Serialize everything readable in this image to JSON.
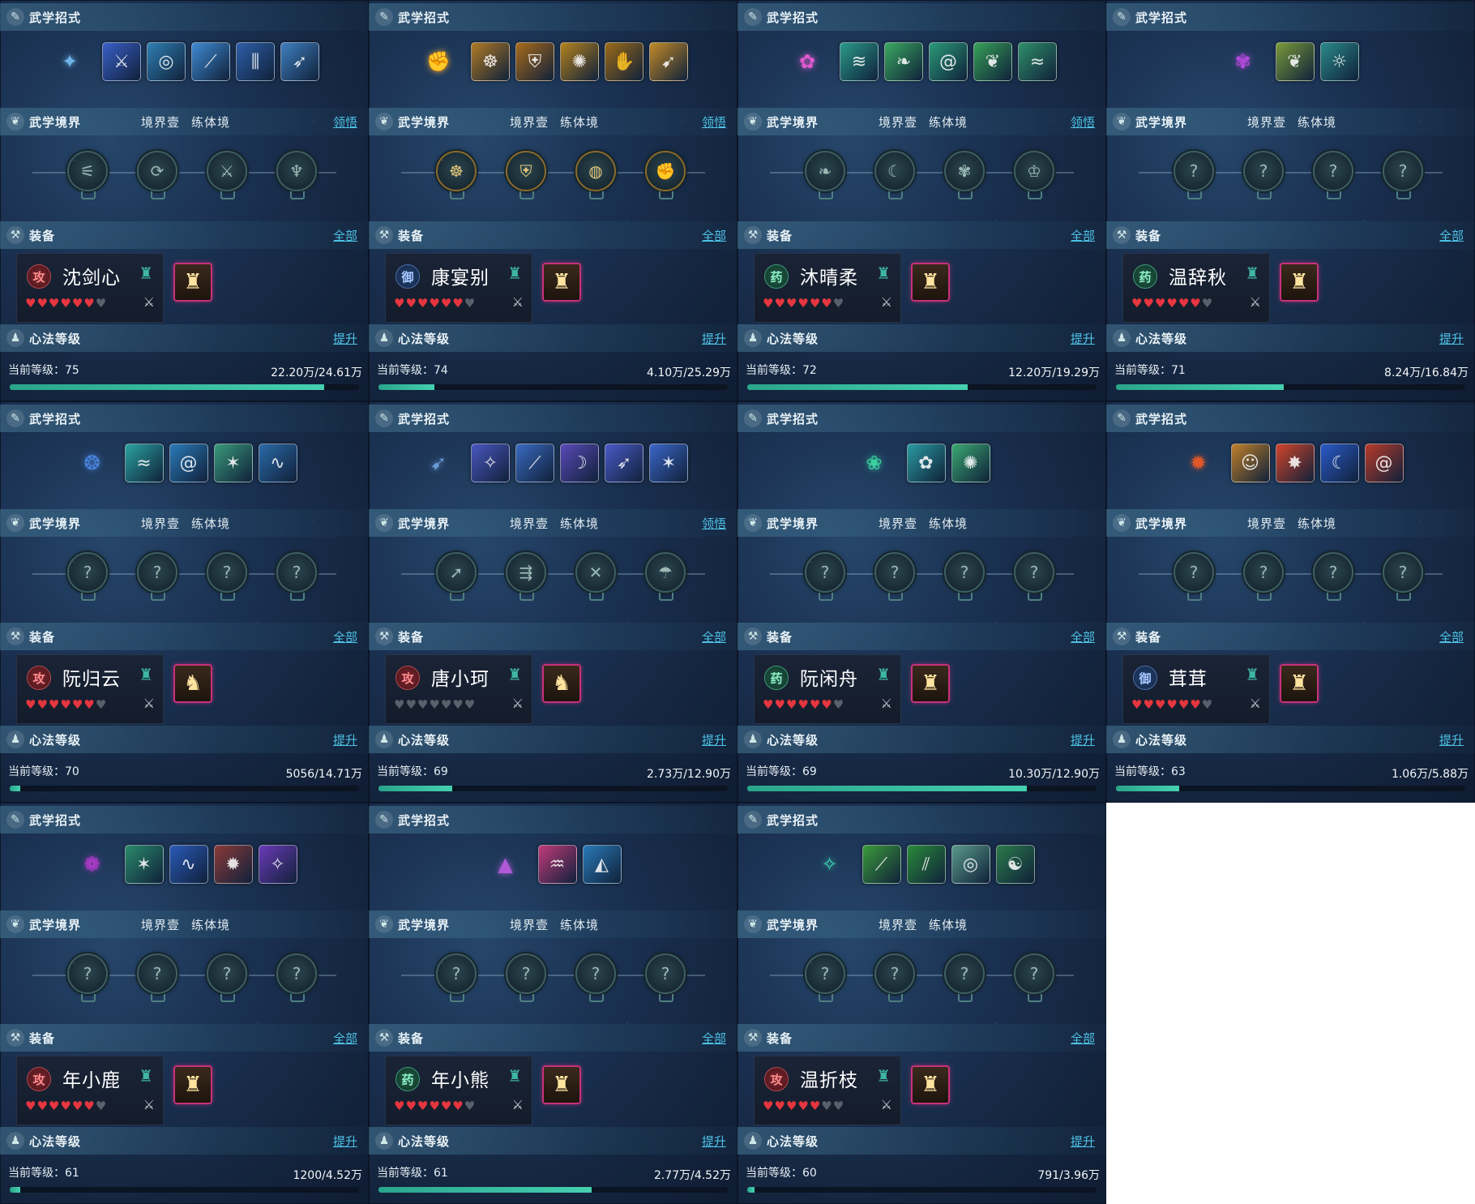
{
  "labels": {
    "skills": "武学招式",
    "realm": "武学境界",
    "equip": "装备",
    "mind": "心法等级",
    "level_prefix": "当前等级：",
    "all": "全部",
    "upgrade": "提升",
    "comprehend": "领悟",
    "realm_stage": "境界壹",
    "realm_name": "练体境"
  },
  "colors": {
    "hp": "#e6363f",
    "hp_empty": "#59606c",
    "accent": "#4ec2e6",
    "xp_bar": "#45d0b0",
    "card_bg": "#1b3253"
  },
  "cards": [
    {
      "name": "沈剑心",
      "role": "攻",
      "role_type": "atk",
      "hearts": 6,
      "level": "75",
      "xp": "22.20万/24.61万",
      "progress": 0.9,
      "comprehend": true,
      "main_skill": {
        "icon": "wind-orb-icon",
        "glyph": "✦",
        "color": "#6fb4e8"
      },
      "skills": [
        {
          "icon": "slash-icon",
          "glyph": "⚔",
          "bg": "#3a5fc8"
        },
        {
          "icon": "whirl-icon",
          "glyph": "◎",
          "bg": "#2f7fb3"
        },
        {
          "icon": "blade-icon",
          "glyph": "⟋",
          "bg": "#3f8bd4"
        },
        {
          "icon": "pierce-icon",
          "glyph": "⫼",
          "bg": "#2d5fa8"
        },
        {
          "icon": "leap-icon",
          "glyph": "➶",
          "bg": "#3f7fc0"
        }
      ],
      "nodes": [
        {
          "icon": "claw-icon",
          "glyph": "⚟",
          "lit": false
        },
        {
          "icon": "swirl-icon",
          "glyph": "⟳",
          "lit": false
        },
        {
          "icon": "sword-icon",
          "glyph": "⚔",
          "lit": false
        },
        {
          "icon": "blade-icon",
          "glyph": "♆",
          "lit": false
        }
      ],
      "gear": {
        "icon": "armor-gold-icon",
        "glyph": "♜"
      }
    },
    {
      "name": "康宴别",
      "role": "御",
      "role_type": "def",
      "hearts": 6,
      "level": "74",
      "xp": "4.10万/25.29万",
      "progress": 0.16,
      "comprehend": true,
      "main_skill": {
        "icon": "golden-fist-icon",
        "glyph": "✊",
        "color": "#e0a83a"
      },
      "skills": [
        {
          "icon": "monk-icon",
          "glyph": "☸",
          "bg": "#b07a24"
        },
        {
          "icon": "bell-icon",
          "glyph": "⛨",
          "bg": "#a86a1a"
        },
        {
          "icon": "shield-icon",
          "glyph": "✺",
          "bg": "#b4821e"
        },
        {
          "icon": "palm-icon",
          "glyph": "✋",
          "bg": "#9a6a18"
        },
        {
          "icon": "kick-icon",
          "glyph": "➹",
          "bg": "#c28a28"
        }
      ],
      "nodes": [
        {
          "icon": "monk-icon",
          "glyph": "☸",
          "lit": true
        },
        {
          "icon": "guard-icon",
          "glyph": "⛨",
          "lit": true
        },
        {
          "icon": "ring-icon",
          "glyph": "◍",
          "lit": true
        },
        {
          "icon": "fist-icon",
          "glyph": "✊",
          "lit": true
        }
      ],
      "gear": {
        "icon": "armor-gold-icon",
        "glyph": "♜"
      }
    },
    {
      "name": "沐晴柔",
      "role": "药",
      "role_type": "heal",
      "hearts": 6,
      "level": "72",
      "xp": "12.20万/19.29万",
      "progress": 0.63,
      "comprehend": true,
      "main_skill": {
        "icon": "fairy-icon",
        "glyph": "✿",
        "color": "#e05ad0"
      },
      "skills": [
        {
          "icon": "wave-icon",
          "glyph": "≋",
          "bg": "#2a9a8a"
        },
        {
          "icon": "leaf-icon",
          "glyph": "❧",
          "bg": "#3aa860"
        },
        {
          "icon": "spiral-icon",
          "glyph": "@",
          "bg": "#2a9a78"
        },
        {
          "icon": "vine-icon",
          "glyph": "❦",
          "bg": "#36a058"
        },
        {
          "icon": "dragon-icon",
          "glyph": "≈",
          "bg": "#2f8f6a"
        }
      ],
      "nodes": [
        {
          "icon": "leaf-icon",
          "glyph": "❧",
          "lit": false
        },
        {
          "icon": "moon-icon",
          "glyph": "☾",
          "lit": false
        },
        {
          "icon": "lotus-icon",
          "glyph": "✾",
          "lit": false
        },
        {
          "icon": "crown-icon",
          "glyph": "♔",
          "lit": false
        }
      ],
      "gear": {
        "icon": "armor-red-icon",
        "glyph": "♜"
      }
    },
    {
      "name": "温辞秋",
      "role": "药",
      "role_type": "heal",
      "hearts": 6,
      "level": "71",
      "xp": "8.24万/16.84万",
      "progress": 0.48,
      "comprehend": false,
      "main_skill": {
        "icon": "flower-icon",
        "glyph": "✾",
        "color": "#b64adf"
      },
      "skills": [
        {
          "icon": "wings-icon",
          "glyph": "❦",
          "bg": "#7a9a3a"
        },
        {
          "icon": "sun-icon",
          "glyph": "☼",
          "bg": "#2a8a8a"
        }
      ],
      "nodes": [
        {
          "icon": "unknown-icon",
          "glyph": "?",
          "lit": false
        },
        {
          "icon": "unknown-icon",
          "glyph": "?",
          "lit": false
        },
        {
          "icon": "unknown-icon",
          "glyph": "?",
          "lit": false
        },
        {
          "icon": "unknown-icon",
          "glyph": "?",
          "lit": false
        }
      ],
      "gear": {
        "icon": "armor-gold-icon",
        "glyph": "♜"
      }
    },
    {
      "name": "阮归云",
      "role": "攻",
      "role_type": "atk",
      "hearts": 6,
      "level": "70",
      "xp": "5056/14.71万",
      "progress": 0.03,
      "comprehend": false,
      "main_skill": {
        "icon": "blue-flame-icon",
        "glyph": "❂",
        "color": "#4a86e0"
      },
      "skills": [
        {
          "icon": "stream-icon",
          "glyph": "≈",
          "bg": "#2aa2a0"
        },
        {
          "icon": "vortex-icon",
          "glyph": "@",
          "bg": "#2a7ab8"
        },
        {
          "icon": "burst-icon",
          "glyph": "✶",
          "bg": "#3a9a7a"
        },
        {
          "icon": "tide-icon",
          "glyph": "∿",
          "bg": "#2a6aa8"
        }
      ],
      "nodes": [
        {
          "icon": "unknown-icon",
          "glyph": "?",
          "lit": false
        },
        {
          "icon": "unknown-icon",
          "glyph": "?",
          "lit": false
        },
        {
          "icon": "unknown-icon",
          "glyph": "?",
          "lit": false
        },
        {
          "icon": "unknown-icon",
          "glyph": "?",
          "lit": false
        }
      ],
      "gear": {
        "icon": "robe-brown-icon",
        "glyph": "♞"
      }
    },
    {
      "name": "唐小珂",
      "role": "攻",
      "role_type": "atk",
      "hearts": 0,
      "level": "69",
      "xp": "2.73万/12.90万",
      "progress": 0.21,
      "comprehend": true,
      "main_skill": {
        "icon": "bird-icon",
        "glyph": "➹",
        "color": "#6a9ad8"
      },
      "skills": [
        {
          "icon": "dancer-icon",
          "glyph": "✧",
          "bg": "#4a56c0"
        },
        {
          "icon": "feather-icon",
          "glyph": "⟋",
          "bg": "#3a6ac0"
        },
        {
          "icon": "scythe-icon",
          "glyph": "☽",
          "bg": "#5a4ab8"
        },
        {
          "icon": "spear-icon",
          "glyph": "➶",
          "bg": "#4a5ac8"
        },
        {
          "icon": "strike-icon",
          "glyph": "✶",
          "bg": "#3a66c8"
        }
      ],
      "nodes": [
        {
          "icon": "bow-icon",
          "glyph": "➚",
          "lit": false
        },
        {
          "icon": "arrows-icon",
          "glyph": "⇶",
          "lit": false
        },
        {
          "icon": "cross-icon",
          "glyph": "✕",
          "lit": false
        },
        {
          "icon": "umbrella-icon",
          "glyph": "☂",
          "lit": false
        }
      ],
      "gear": {
        "icon": "robe-brown-icon",
        "glyph": "♞"
      }
    },
    {
      "name": "阮闲舟",
      "role": "药",
      "role_type": "heal",
      "hearts": 6,
      "level": "69",
      "xp": "10.30万/12.90万",
      "progress": 0.8,
      "comprehend": false,
      "main_skill": {
        "icon": "leaf-spirit-icon",
        "glyph": "❀",
        "color": "#3ad0a0"
      },
      "skills": [
        {
          "icon": "bloom-icon",
          "glyph": "✿",
          "bg": "#2a9aa0"
        },
        {
          "icon": "sunburst-icon",
          "glyph": "✺",
          "bg": "#3aa870"
        }
      ],
      "nodes": [
        {
          "icon": "unknown-icon",
          "glyph": "?",
          "lit": false
        },
        {
          "icon": "unknown-icon",
          "glyph": "?",
          "lit": false
        },
        {
          "icon": "unknown-icon",
          "glyph": "?",
          "lit": false
        },
        {
          "icon": "unknown-icon",
          "glyph": "?",
          "lit": false
        }
      ],
      "gear": {
        "icon": "armor-dark-icon",
        "glyph": "♜"
      }
    },
    {
      "name": "茸茸",
      "role": "御",
      "role_type": "def",
      "hearts": 6,
      "level": "63",
      "xp": "1.06万/5.88万",
      "progress": 0.18,
      "comprehend": false,
      "main_skill": {
        "icon": "fire-spirit-icon",
        "glyph": "✹",
        "color": "#e0582a"
      },
      "skills": [
        {
          "icon": "face-icon",
          "glyph": "☺",
          "bg": "#c0802a"
        },
        {
          "icon": "explosion-icon",
          "glyph": "✸",
          "bg": "#d0442a"
        },
        {
          "icon": "crescent-icon",
          "glyph": "☾",
          "bg": "#2a5ac8"
        },
        {
          "icon": "spiral-fire-icon",
          "glyph": "@",
          "bg": "#b83a2a"
        }
      ],
      "nodes": [
        {
          "icon": "unknown-icon",
          "glyph": "?",
          "lit": false
        },
        {
          "icon": "unknown-icon",
          "glyph": "?",
          "lit": false
        },
        {
          "icon": "unknown-icon",
          "glyph": "?",
          "lit": false
        },
        {
          "icon": "unknown-icon",
          "glyph": "?",
          "lit": false
        }
      ],
      "gear": {
        "icon": "armor-silver-icon",
        "glyph": "♜"
      }
    },
    {
      "name": "年小鹿",
      "role": "攻",
      "role_type": "atk",
      "hearts": 6,
      "level": "61",
      "xp": "1200/4.52万",
      "progress": 0.03,
      "comprehend": false,
      "main_skill": {
        "icon": "purple-rune-icon",
        "glyph": "❁",
        "color": "#c03ad8"
      },
      "skills": [
        {
          "icon": "thorn-icon",
          "glyph": "✶",
          "bg": "#2a8a6a"
        },
        {
          "icon": "wave-blue-icon",
          "glyph": "∿",
          "bg": "#2a5ab8"
        },
        {
          "icon": "beast-icon",
          "glyph": "✹",
          "bg": "#8a3a3a"
        },
        {
          "icon": "shadow-icon",
          "glyph": "✧",
          "bg": "#6a3ab8"
        }
      ],
      "nodes": [
        {
          "icon": "unknown-icon",
          "glyph": "?",
          "lit": false
        },
        {
          "icon": "unknown-icon",
          "glyph": "?",
          "lit": false
        },
        {
          "icon": "unknown-icon",
          "glyph": "?",
          "lit": false
        },
        {
          "icon": "unknown-icon",
          "glyph": "?",
          "lit": false
        }
      ],
      "gear": {
        "icon": "armor-gold-icon",
        "glyph": "♜"
      }
    },
    {
      "name": "年小熊",
      "role": "药",
      "role_type": "heal",
      "hearts": 6,
      "level": "61",
      "xp": "2.77万/4.52万",
      "progress": 0.61,
      "comprehend": false,
      "main_skill": {
        "icon": "crystal-icon",
        "glyph": "▲",
        "color": "#b05ad8"
      },
      "skills": [
        {
          "icon": "fang-icon",
          "glyph": "♒",
          "bg": "#c03a7a"
        },
        {
          "icon": "shark-icon",
          "glyph": "◭",
          "bg": "#2a7ab8"
        }
      ],
      "nodes": [
        {
          "icon": "unknown-icon",
          "glyph": "?",
          "lit": false
        },
        {
          "icon": "unknown-icon",
          "glyph": "?",
          "lit": false
        },
        {
          "icon": "unknown-icon",
          "glyph": "?",
          "lit": false
        },
        {
          "icon": "unknown-icon",
          "glyph": "?",
          "lit": false
        }
      ],
      "gear": {
        "icon": "armor-gold-icon",
        "glyph": "♜"
      }
    },
    {
      "name": "温折枝",
      "role": "攻",
      "role_type": "atk",
      "hearts": 5,
      "level": "60",
      "xp": "791/3.96万",
      "progress": 0.02,
      "comprehend": false,
      "main_skill": {
        "icon": "jade-beast-icon",
        "glyph": "✧",
        "color": "#3ad0b0"
      },
      "skills": [
        {
          "icon": "green-slash-icon",
          "glyph": "⟋",
          "bg": "#3a9a3a"
        },
        {
          "icon": "double-slash-icon",
          "glyph": "⫽",
          "bg": "#2a8a3a"
        },
        {
          "icon": "ring-icon",
          "glyph": "◎",
          "bg": "#5a9a8a"
        },
        {
          "icon": "yin-yang-icon",
          "glyph": "☯",
          "bg": "#2a7a4a"
        }
      ],
      "nodes": [
        {
          "icon": "unknown-icon",
          "glyph": "?",
          "lit": false
        },
        {
          "icon": "unknown-icon",
          "glyph": "?",
          "lit": false
        },
        {
          "icon": "unknown-icon",
          "glyph": "?",
          "lit": false
        },
        {
          "icon": "unknown-icon",
          "glyph": "?",
          "lit": false
        }
      ],
      "gear": {
        "icon": "armor-dark-icon",
        "glyph": "♜"
      }
    }
  ]
}
